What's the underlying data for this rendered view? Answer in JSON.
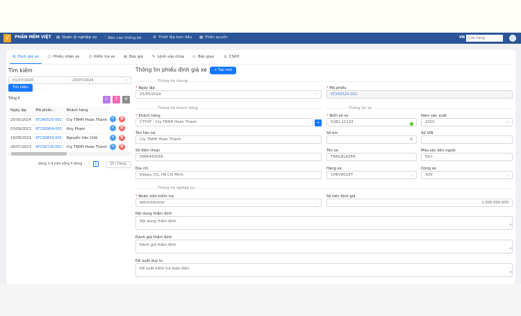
{
  "nav": {
    "brand": "PHẦN MỀM VIỆT",
    "items": [
      {
        "label": "Quản lý nghiệp vụ",
        "icon": "document-icon"
      },
      {
        "label": "Báo cáo thống kê",
        "icon": "chart-icon"
      },
      {
        "label": "Thiết lập ban đầu",
        "icon": "gear-icon"
      },
      {
        "label": "Phân quyền",
        "icon": "grid-icon"
      }
    ],
    "lang": "VN",
    "store_placeholder": "Cửa hàng"
  },
  "tabs": [
    {
      "label": "Định giá xe",
      "active": true
    },
    {
      "label": "Phiếu nhận xe"
    },
    {
      "label": "Kiểm tra xe"
    },
    {
      "label": "Báo giá"
    },
    {
      "label": "Lệnh sửa chữa"
    },
    {
      "label": "Bàn giao"
    },
    {
      "label": "CSKH"
    }
  ],
  "search": {
    "title": "Tìm kiếm",
    "from": "01/07/2020",
    "to": "23/07/2024",
    "button": "Tìm kiếm",
    "total": "Tổng 4",
    "tools": [
      "C",
      "T",
      "⚙"
    ]
  },
  "table": {
    "headers": [
      "Ngày lập",
      "Mã phiếu",
      "Khách hàng"
    ],
    "rows": [
      [
        "25/05/2024",
        "KT240525-001",
        "Cty TNHH Hoàn Thành"
      ],
      [
        "03/09/2023",
        "KT230904-001",
        "Huy Phạm"
      ],
      [
        "19/08/2023",
        "KT230819-001",
        "Nguyễn Văn Chồi"
      ],
      [
        "26/07/2023",
        "KT230726-001",
        "Cty TNHH Hoàn Thành"
      ]
    ],
    "pagination": "dòng 1-4 trên tổng 4 dòng",
    "page": "1",
    "page_size": "10 / trang"
  },
  "form": {
    "title": "Thông tin phiếu định giá xe",
    "create": "+ Tạo mới",
    "sec_general": "Thông tin chung",
    "sec_customer": "Thông tin khách hàng",
    "sec_vehicle": "Thông tin xe",
    "sec_business": "Thông tin nghiệp vụ",
    "ngay_lap": {
      "label": "Ngày lập",
      "value": "25/05/2024"
    },
    "ma_phieu": {
      "label": "Mã phiếu",
      "value": "KT240525-001"
    },
    "khach_hang": {
      "label": "Khách hàng",
      "value": "CTYHT - Cty TNHH Hoàn Thành"
    },
    "ten_lien_he": {
      "label": "Tên liên hệ",
      "value": "Cty TNHH Hoàn Thành"
    },
    "so_dien_thoai": {
      "label": "Số điện thoại",
      "value": "0966443558"
    },
    "dia_chi": {
      "label": "Địa chỉ",
      "value": "Đakao, Q1, Hồ Chí Minh"
    },
    "bien_so": {
      "label": "Biển số xe",
      "value": "51B1-11133"
    },
    "nam_sx": {
      "label": "Năm sản xuất",
      "value": "2010"
    },
    "so_km": {
      "label": "Số km",
      "value": "0"
    },
    "so_vin": {
      "label": "Số VIN",
      "value": ""
    },
    "ten_xe": {
      "label": "Tên xe",
      "value": "TRAILBLAZER"
    },
    "mau_sac": {
      "label": "Màu sắc bên ngoài",
      "value": "Đen"
    },
    "hang_xe": {
      "label": "Hãng xe",
      "value": "CHEVROLET"
    },
    "dong_xe": {
      "label": "Dòng xe",
      "value": "SUV"
    },
    "nhan_vien": {
      "label": "Nhân viên kiểm tra",
      "value": "Administrator"
    },
    "so_tien": {
      "label": "Số tiền định giá",
      "value": "1,000,000,000"
    },
    "noi_dung": {
      "label": "Nội dung thẩm định",
      "value": "Nội dung thẩm định"
    },
    "danh_gia": {
      "label": "Đánh giá thẩm định",
      "value": "Đánh giá thẩm định"
    },
    "de_xuat": {
      "label": "Đề xuất duy tu",
      "value": "Đề xuất kiểm tra toàn diện"
    }
  },
  "colors": {
    "nav": "#2b5597",
    "primary": "#1677ff",
    "edit": "#4a9ff5",
    "delete": "#f25f5c"
  }
}
